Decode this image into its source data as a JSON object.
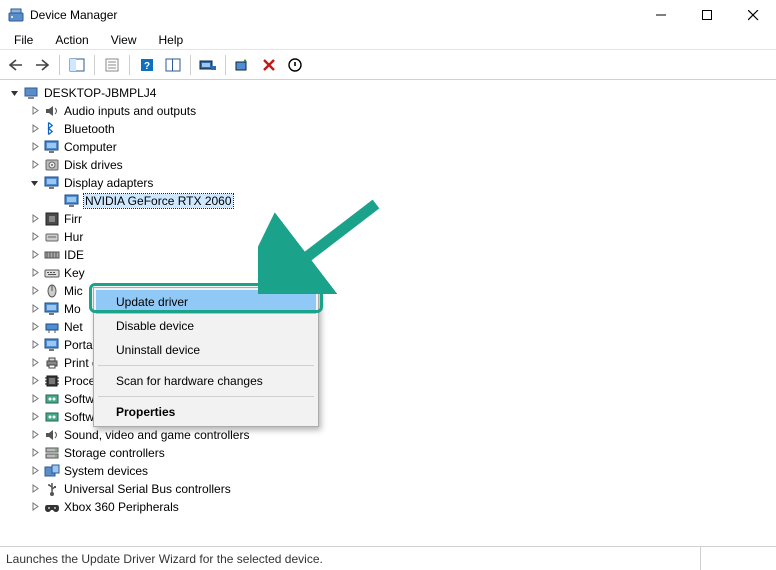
{
  "window": {
    "title": "Device Manager"
  },
  "menu": {
    "file": "File",
    "action": "Action",
    "view": "View",
    "help": "Help"
  },
  "tree": {
    "root": "DESKTOP-JBMPLJ4",
    "nodes": [
      {
        "label": "Audio inputs and outputs",
        "icon": "speaker"
      },
      {
        "label": "Bluetooth",
        "icon": "bluetooth"
      },
      {
        "label": "Computer",
        "icon": "monitor"
      },
      {
        "label": "Disk drives",
        "icon": "disk"
      },
      {
        "label": "Display adapters",
        "icon": "monitor",
        "expanded": true,
        "children": [
          {
            "label": "NVIDIA GeForce RTX 2060",
            "icon": "monitor",
            "selected": true
          }
        ]
      },
      {
        "label": "Firr",
        "icon": "firmware"
      },
      {
        "label": "Hur",
        "icon": "hid"
      },
      {
        "label": "IDE",
        "icon": "ide"
      },
      {
        "label": "Key",
        "icon": "keyboard"
      },
      {
        "label": "Mic",
        "icon": "mouse"
      },
      {
        "label": "Mo",
        "icon": "monitor"
      },
      {
        "label": "Net",
        "icon": "network"
      },
      {
        "label": "Portable Devices",
        "icon": "monitor"
      },
      {
        "label": "Print queues",
        "icon": "printer"
      },
      {
        "label": "Processors",
        "icon": "cpu"
      },
      {
        "label": "Software components",
        "icon": "component"
      },
      {
        "label": "Software devices",
        "icon": "component"
      },
      {
        "label": "Sound, video and game controllers",
        "icon": "speaker"
      },
      {
        "label": "Storage controllers",
        "icon": "storage"
      },
      {
        "label": "System devices",
        "icon": "system"
      },
      {
        "label": "Universal Serial Bus controllers",
        "icon": "usb"
      },
      {
        "label": "Xbox 360 Peripherals",
        "icon": "gamepad"
      }
    ]
  },
  "context_menu": {
    "items": [
      {
        "label": "Update driver",
        "highlight": true
      },
      {
        "label": "Disable device"
      },
      {
        "label": "Uninstall device"
      },
      {
        "sep": true
      },
      {
        "label": "Scan for hardware changes"
      },
      {
        "sep": true
      },
      {
        "label": "Properties",
        "bold": true
      }
    ]
  },
  "statusbar": {
    "text": "Launches the Update Driver Wizard for the selected device."
  },
  "colors": {
    "annotation": "#1aa28a",
    "selection": "#cde8ff",
    "menu_highlight": "#90c8f6"
  }
}
